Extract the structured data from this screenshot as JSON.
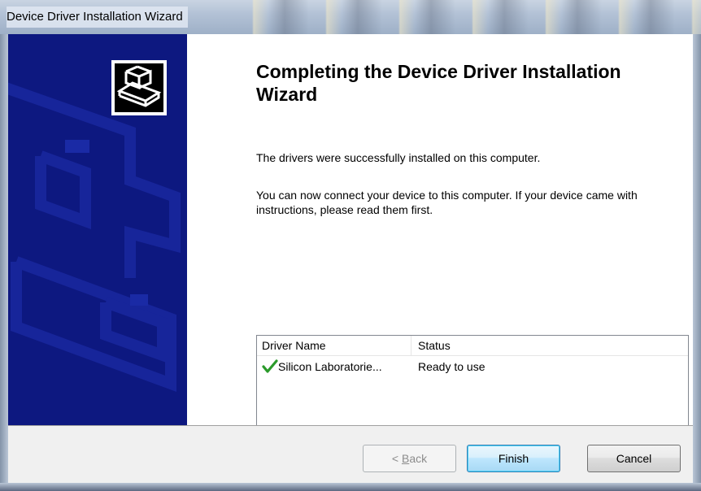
{
  "window": {
    "title": "Device Driver Installation Wizard"
  },
  "content": {
    "heading": "Completing the Device Driver Installation Wizard",
    "message_1": "The drivers were successfully installed on this computer.",
    "message_2": "You can now connect your device to this computer. If your device came with instructions, please read them first."
  },
  "driver_list": {
    "columns": [
      "Driver Name",
      "Status"
    ],
    "rows": [
      {
        "icon": "check-icon",
        "driver_name": "Silicon Laboratorie...",
        "status": "Ready to use"
      }
    ]
  },
  "buttons": {
    "back_prefix": "< ",
    "back_accel": "B",
    "back_rest": "ack",
    "finish": "Finish",
    "cancel": "Cancel"
  },
  "colors": {
    "banner": "#0d1880",
    "check": "#2a9a2a",
    "finish_border": "#3c7fb1"
  }
}
